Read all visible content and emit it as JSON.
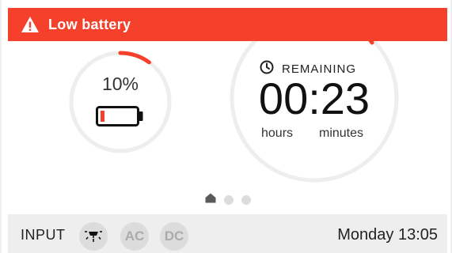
{
  "alert": {
    "icon": "warning-icon",
    "text": "Low battery",
    "color": "#f5402c"
  },
  "battery": {
    "percent_text": "10%",
    "percent_value": 0.1,
    "icon": "battery-icon",
    "level_color": "#f5402c"
  },
  "runtime": {
    "icon": "clock-icon",
    "label": "REMAINING",
    "time": "00:23",
    "hours_label": "hours",
    "minutes_label": "minutes"
  },
  "pager": {
    "icons": [
      "home-icon",
      "dot",
      "dot"
    ],
    "active_index": 0
  },
  "footer": {
    "input_label": "INPUT",
    "sources": [
      {
        "name": "solar",
        "icon": "solar-icon",
        "label": ""
      },
      {
        "name": "ac",
        "icon": "",
        "label": "AC"
      },
      {
        "name": "dc",
        "icon": "",
        "label": "DC"
      }
    ],
    "datetime": "Monday 13:05"
  },
  "colors": {
    "accent": "#f5402c",
    "footer_bg": "#eeeeee",
    "ring_bg": "#eeeeee",
    "inactive": "#dddddd"
  }
}
